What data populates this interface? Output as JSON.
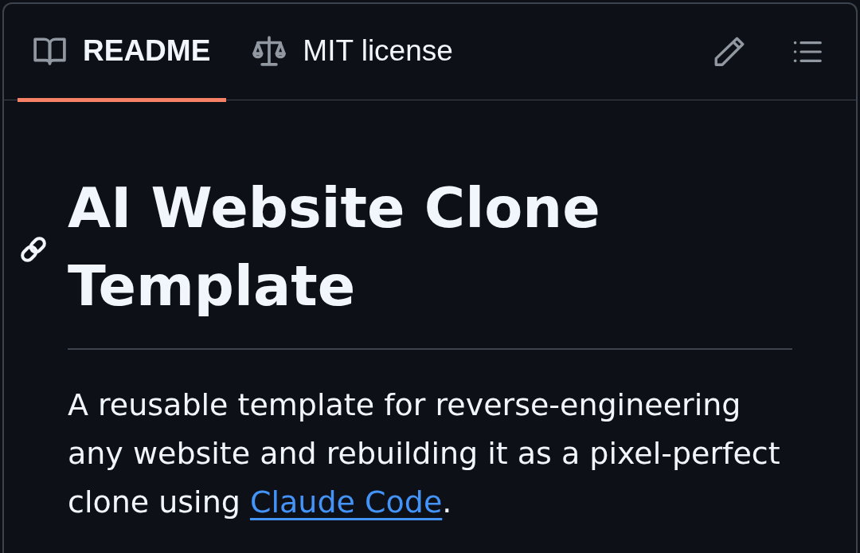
{
  "tabs": [
    {
      "kind": "readme",
      "label": "README",
      "selected": true
    },
    {
      "kind": "license",
      "label": "MIT license",
      "selected": false
    }
  ],
  "heading": "AI Website Clone Template",
  "description": [
    {
      "kind": "text",
      "text": "A reusable template for reverse-engineering any website and rebuilding it as a pixel-perfect clone using "
    },
    {
      "kind": "link",
      "text": "Claude Code"
    },
    {
      "kind": "text",
      "text": "."
    }
  ]
}
